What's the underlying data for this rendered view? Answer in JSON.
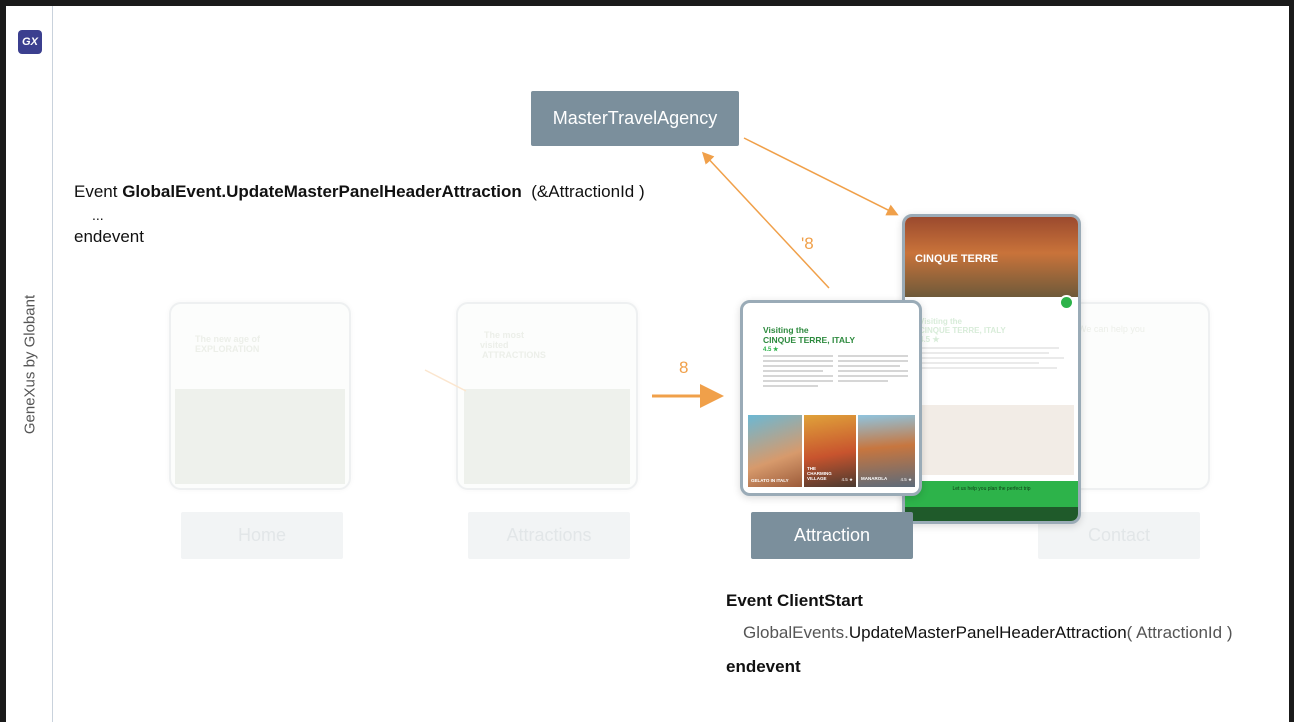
{
  "sidebar": {
    "logo": "GX",
    "brand": "GeneXus by Globant"
  },
  "code_top": {
    "line1_prefix": "Event ",
    "line1_bold": "GlobalEvent.UpdateMasterPanelHeaderAttraction",
    "line1_suffix": "  (&AttractionId )",
    "line2": "...",
    "line3": "endevent"
  },
  "nodes": {
    "master": "MasterTravelAgency",
    "home": "Home",
    "attractions": "Attractions",
    "attraction": "Attraction",
    "contact": "Contact"
  },
  "arrows": {
    "to_attraction": "8",
    "to_master": "'8"
  },
  "ghosts": {
    "home_line1": "The new age of",
    "home_line2": "EXPLORATION",
    "attractions_line1": "The most",
    "attractions_line2": "visited",
    "attractions_line3": "ATTRACTIONS",
    "contact_line": "We can help you"
  },
  "attraction_shot": {
    "title_line1": "Visiting the",
    "title_line2": "CINQUE TERRE, ITALY",
    "rating": "4.5 ★",
    "tiles": [
      "GELATO IN ITALY",
      "THE CHARMING VILLAGE",
      "MANAROLA"
    ],
    "tile_ratings": [
      "",
      "4.5 ★",
      "4.5 ★"
    ]
  },
  "master_shot": {
    "hero": "CINQUE TERRE",
    "title_line1": "Visiting the",
    "title_line2": "CINQUE TERRE, ITALY",
    "rating": "4.5 ★",
    "cta": "Let us help you plan the perfect trip"
  },
  "code_bottom": {
    "line1": "Event ClientStart",
    "line2_pre": "GlobalEvents.",
    "line2_bold": "UpdateMasterPanelHeaderAttraction",
    "line2_post": "( AttractionId )",
    "line3": "endevent"
  },
  "colors": {
    "node": "#7b8f9c",
    "arrow": "#f0a04a",
    "green": "#2db34a",
    "logo": "#3b3f8f"
  }
}
